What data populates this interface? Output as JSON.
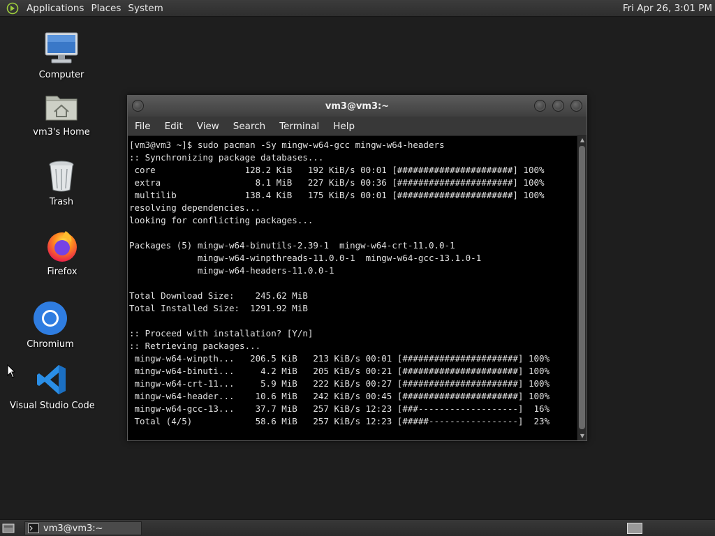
{
  "top_panel": {
    "menus": [
      "Applications",
      "Places",
      "System"
    ],
    "clock": "Fri Apr 26,  3:01 PM"
  },
  "desktop_icons": [
    {
      "label": "Computer",
      "icon": "computer-icon"
    },
    {
      "label": "vm3's Home",
      "icon": "home-folder-icon"
    },
    {
      "label": "Trash",
      "icon": "trash-icon"
    },
    {
      "label": "Firefox",
      "icon": "firefox-icon"
    },
    {
      "label": "Chromium",
      "icon": "chromium-icon"
    },
    {
      "label": "Visual Studio Code",
      "icon": "vscode-icon"
    }
  ],
  "terminal": {
    "title": "vm3@vm3:~",
    "menus": [
      "File",
      "Edit",
      "View",
      "Search",
      "Terminal",
      "Help"
    ],
    "lines": [
      "[vm3@vm3 ~]$ sudo pacman -Sy mingw-w64-gcc mingw-w64-headers",
      ":: Synchronizing package databases...",
      " core                 128.2 KiB   192 KiB/s 00:01 [######################] 100%",
      " extra                  8.1 MiB   227 KiB/s 00:36 [######################] 100%",
      " multilib             138.4 KiB   175 KiB/s 00:01 [######################] 100%",
      "resolving dependencies...",
      "looking for conflicting packages...",
      "",
      "Packages (5) mingw-w64-binutils-2.39-1  mingw-w64-crt-11.0.0-1",
      "             mingw-w64-winpthreads-11.0.0-1  mingw-w64-gcc-13.1.0-1",
      "             mingw-w64-headers-11.0.0-1",
      "",
      "Total Download Size:    245.62 MiB",
      "Total Installed Size:  1291.92 MiB",
      "",
      ":: Proceed with installation? [Y/n]",
      ":: Retrieving packages...",
      " mingw-w64-winpth...   206.5 KiB   213 KiB/s 00:01 [######################] 100%",
      " mingw-w64-binuti...     4.2 MiB   205 KiB/s 00:21 [######################] 100%",
      " mingw-w64-crt-11...     5.9 MiB   222 KiB/s 00:27 [######################] 100%",
      " mingw-w64-header...    10.6 MiB   242 KiB/s 00:45 [######################] 100%",
      " mingw-w64-gcc-13...    37.7 MiB   257 KiB/s 12:23 [###-------------------]  16%",
      " Total (4/5)            58.6 MiB   257 KiB/s 12:23 [#####-----------------]  23%"
    ]
  },
  "taskbar": {
    "tasks": [
      {
        "label": "vm3@vm3:~",
        "icon": "terminal-icon"
      }
    ]
  }
}
